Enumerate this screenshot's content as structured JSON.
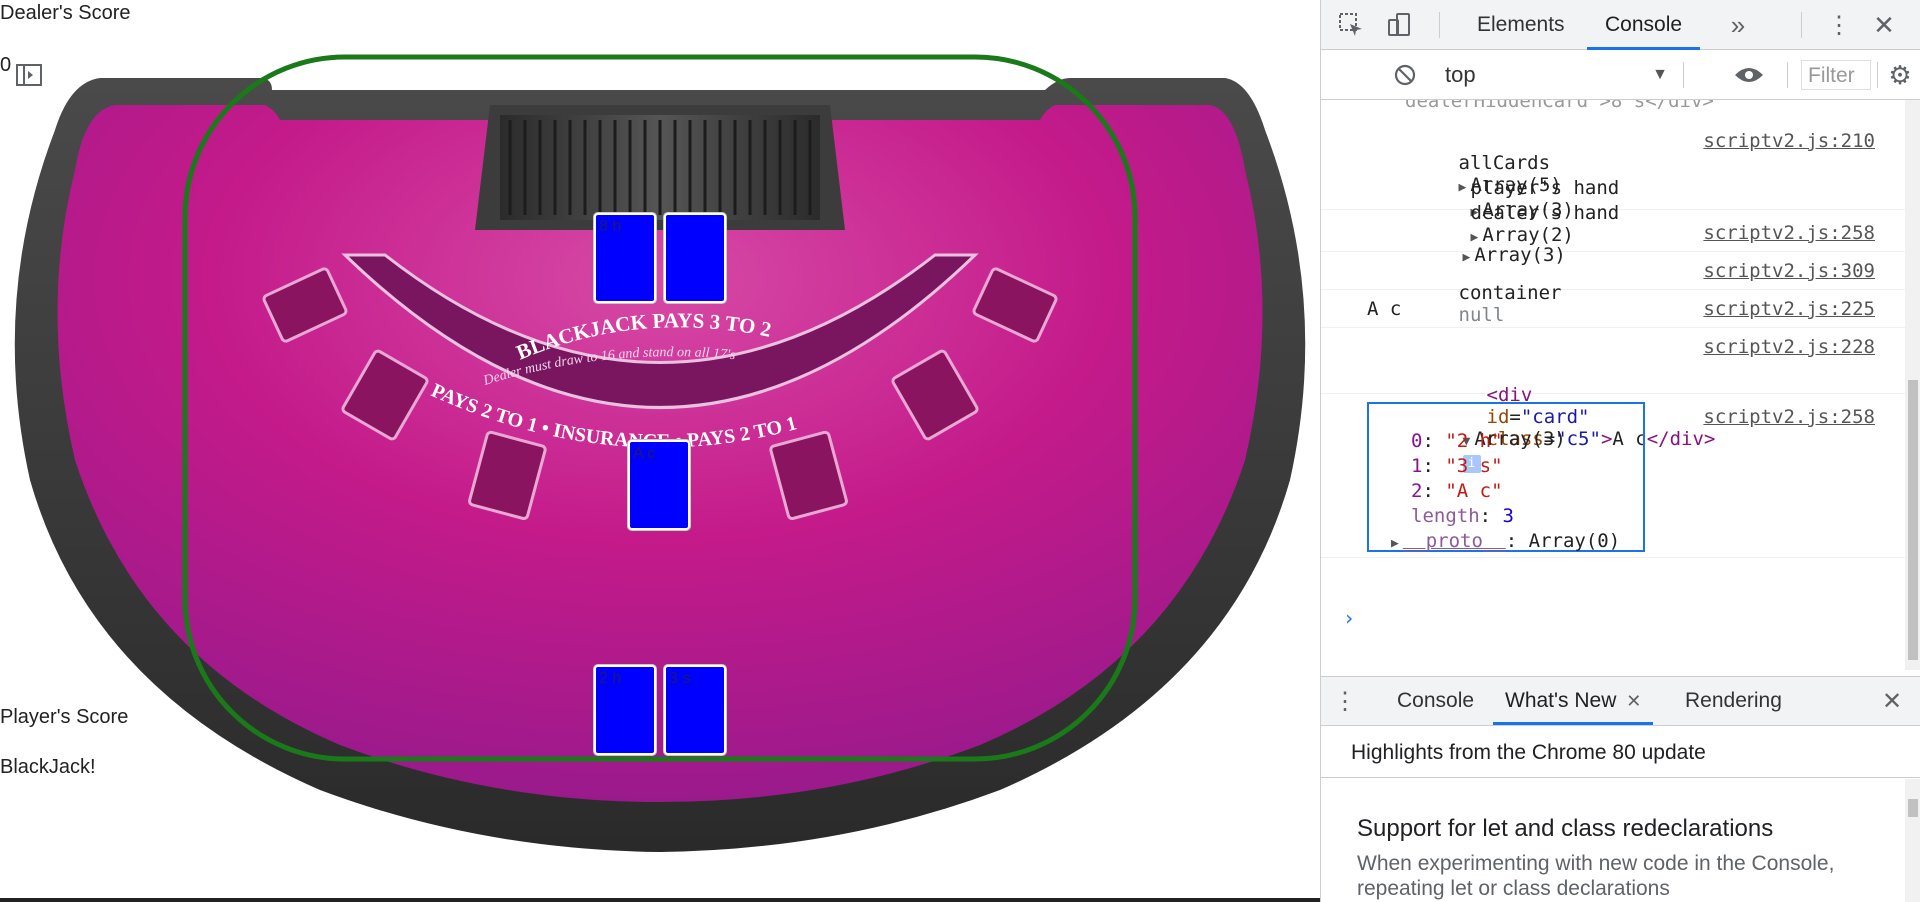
{
  "game": {
    "dealer_score_label": "Dealer's Score",
    "dealer_score_value": "0",
    "player_score_label": "Player's Score",
    "player_status": "BlackJack!",
    "table_text": {
      "arc_main": "BLACKJACK PAYS 3 TO 2",
      "arc_sub": "Dealer must draw to 16 and stand on all 17's",
      "arc_bottom": "PAYS 2 TO 1 • INSURANCE • PAYS 2 TO 1"
    },
    "dealer_cards": [
      "8 h",
      ""
    ],
    "middle_card": "A c",
    "player_cards": [
      "2 h",
      "3 s"
    ],
    "colors": {
      "felt": "#c41a8a",
      "rim": "#3a3a3a",
      "card": "#0000ff",
      "outline": "#1a7a1a"
    }
  },
  "devtools": {
    "tabs": [
      "Elements",
      "Console"
    ],
    "active_tab": "Console",
    "more_tabs_icon": "chevron-double-right",
    "context": "top",
    "filter_placeholder": "Filter",
    "messages": {
      "cut_line": "dealerHiddenCard\">8 s</div>",
      "allcards_label": "allCards",
      "allcards_value": "Array(5)",
      "allcards_src": "scriptv2.js:210",
      "players_hand_label": "player's hand",
      "players_hand_value": "Array(3)",
      "dealers_hand_label": "dealer's hand",
      "dealers_hand_value": "Array(2)",
      "array3_label": "Array(3)",
      "array3_src": "scriptv2.js:258",
      "container_label": "container",
      "container_value": "null",
      "container_src": "scriptv2.js:309",
      "ac_text": "A c",
      "ac_src": "scriptv2.js:225",
      "div_src": "scriptv2.js:228",
      "div_tag_open": "<div",
      "div_attr1_name": "id",
      "div_attr1_value": "\"card\"",
      "div_attr2_name": "class",
      "div_attr2_value": "\"c5\"",
      "div_text": "A c",
      "div_tag_close": "</div>",
      "expanded_label": "Array(3)",
      "expanded_src": "scriptv2.js:258",
      "items": [
        {
          "key": "0",
          "value": "\"2 h\""
        },
        {
          "key": "1",
          "value": "\"3 s\""
        },
        {
          "key": "2",
          "value": "\"A c\""
        }
      ],
      "length_key": "length",
      "length_value": "3",
      "proto_key": "__proto__",
      "proto_value": "Array(0)"
    },
    "drawer": {
      "tabs": [
        "Console",
        "What's New",
        "Rendering"
      ],
      "active_tab": "What's New",
      "header": "Highlights from the Chrome 80 update",
      "item_title": "Support for let and class redeclarations",
      "item_text": "When experimenting with new code in the Console, repeating let or class declarations"
    },
    "accent": "#1a73e8"
  }
}
